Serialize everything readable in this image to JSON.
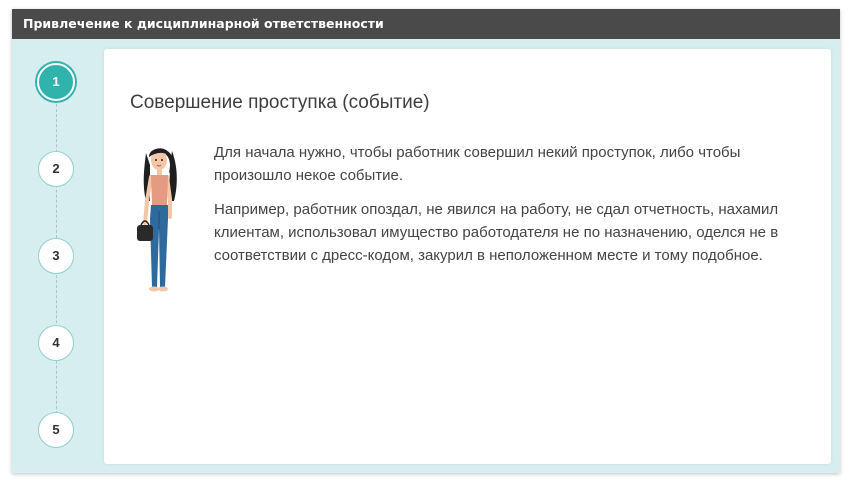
{
  "window": {
    "title": "Привлечение к дисциплинарной ответственности"
  },
  "steps": [
    {
      "label": "1",
      "active": true
    },
    {
      "label": "2",
      "active": false
    },
    {
      "label": "3",
      "active": false
    },
    {
      "label": "4",
      "active": false
    },
    {
      "label": "5",
      "active": false
    }
  ],
  "content": {
    "title": "Совершение проступка (событие)",
    "paragraph1": "Для начала нужно, чтобы работник совершил некий проступок, либо чтобы произошло некое событие.",
    "paragraph2": "Например, работник опоздал, не явился на работу, не сдал отчетность, нахамил клиентам,  использовал имущество работодателя не по назначению, оделся не в соответствии с дресс-кодом, закурил в неположенном месте и тому подобное."
  },
  "colors": {
    "title_bar": "#4a4a4a",
    "background": "#d6eef0",
    "accent": "#30b3ad",
    "step_border": "#8fcfcb",
    "text": "#444444"
  }
}
